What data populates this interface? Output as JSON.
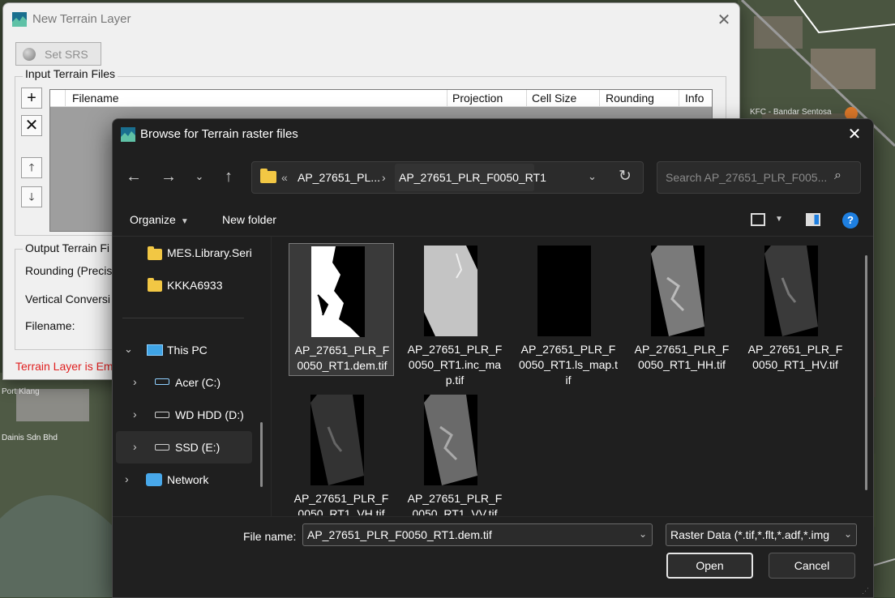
{
  "terrain_dialog": {
    "title": "New Terrain Layer",
    "set_srs_label": "Set SRS ...",
    "input_group_label": "Input Terrain Files",
    "columns": [
      "Filename",
      "Projection",
      "Cell Size",
      "Rounding",
      "Info"
    ],
    "output_group_label": "Output Terrain Fi",
    "rounding_label": "Rounding (Precis",
    "vertical_label": "Vertical Conversi",
    "filename_label": "Filename:",
    "error_text": "Terrain Layer is Em"
  },
  "browse_dialog": {
    "title": "Browse for Terrain raster files",
    "breadcrumb": {
      "overflow": "«",
      "parent": "AP_27651_PL...",
      "separator": "›",
      "current": "AP_27651_PLR_F0050_RT1"
    },
    "search_placeholder": "Search AP_27651_PLR_F005...",
    "toolbar": {
      "organize": "Organize",
      "new_folder": "New folder"
    },
    "nav": {
      "quick_folders": [
        "MES.Library.Seri",
        "KKKA6933"
      ],
      "this_pc": "This PC",
      "drives": [
        "Acer (C:)",
        "WD HDD (D:)",
        "SSD (E:)"
      ],
      "network": "Network"
    },
    "files": [
      {
        "name": "AP_27651_PLR_F0050_RT1.dem.tif",
        "selected": true
      },
      {
        "name": "AP_27651_PLR_F0050_RT1.inc_map.tif",
        "selected": false
      },
      {
        "name": "AP_27651_PLR_F0050_RT1.ls_map.tif",
        "selected": false
      },
      {
        "name": "AP_27651_PLR_F0050_RT1_HH.tif",
        "selected": false
      },
      {
        "name": "AP_27651_PLR_F0050_RT1_HV.tif",
        "selected": false
      },
      {
        "name": "AP_27651_PLR_F0050_RT1_VH.tif",
        "selected": false
      },
      {
        "name": "AP_27651_PLR_F0050_RT1_VV.tif",
        "selected": false
      }
    ],
    "file_name_label": "File name:",
    "file_name_value": "AP_27651_PLR_F0050_RT1.dem.tif",
    "filter_value": "Raster Data (*.tif,*.flt,*.adf,*.img",
    "open_label": "Open",
    "cancel_label": "Cancel"
  },
  "map_labels": [
    "KFC - Bandar Sentosa",
    "Dainis Sdn Bhd",
    "Port Klang"
  ],
  "colors": {
    "accent": "#1e7fe0",
    "folder": "#f2c744",
    "error": "#e02020",
    "dialog_dark": "#1f1f1f"
  }
}
